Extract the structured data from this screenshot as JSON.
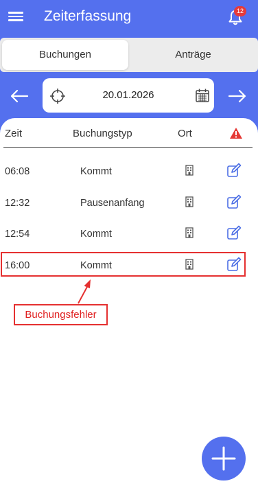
{
  "app": {
    "title": "Zeiterfassung",
    "notification_count": "12"
  },
  "tabs": [
    {
      "label": "Buchungen",
      "active": true
    },
    {
      "label": "Anträge",
      "active": false
    }
  ],
  "date_nav": {
    "date": "20.01.2026"
  },
  "table": {
    "headers": {
      "time": "Zeit",
      "type": "Buchungstyp",
      "location": "Ort"
    },
    "rows": [
      {
        "time": "06:08",
        "type": "Kommt"
      },
      {
        "time": "12:32",
        "type": "Pausenanfang"
      },
      {
        "time": "12:54",
        "type": "Kommt"
      },
      {
        "time": "16:00",
        "type": "Kommt"
      }
    ]
  },
  "annotation": {
    "label": "Buchungsfehler"
  },
  "colors": {
    "primary": "#5470ee",
    "error": "#e53030",
    "icon_blue": "#4a6de5"
  }
}
